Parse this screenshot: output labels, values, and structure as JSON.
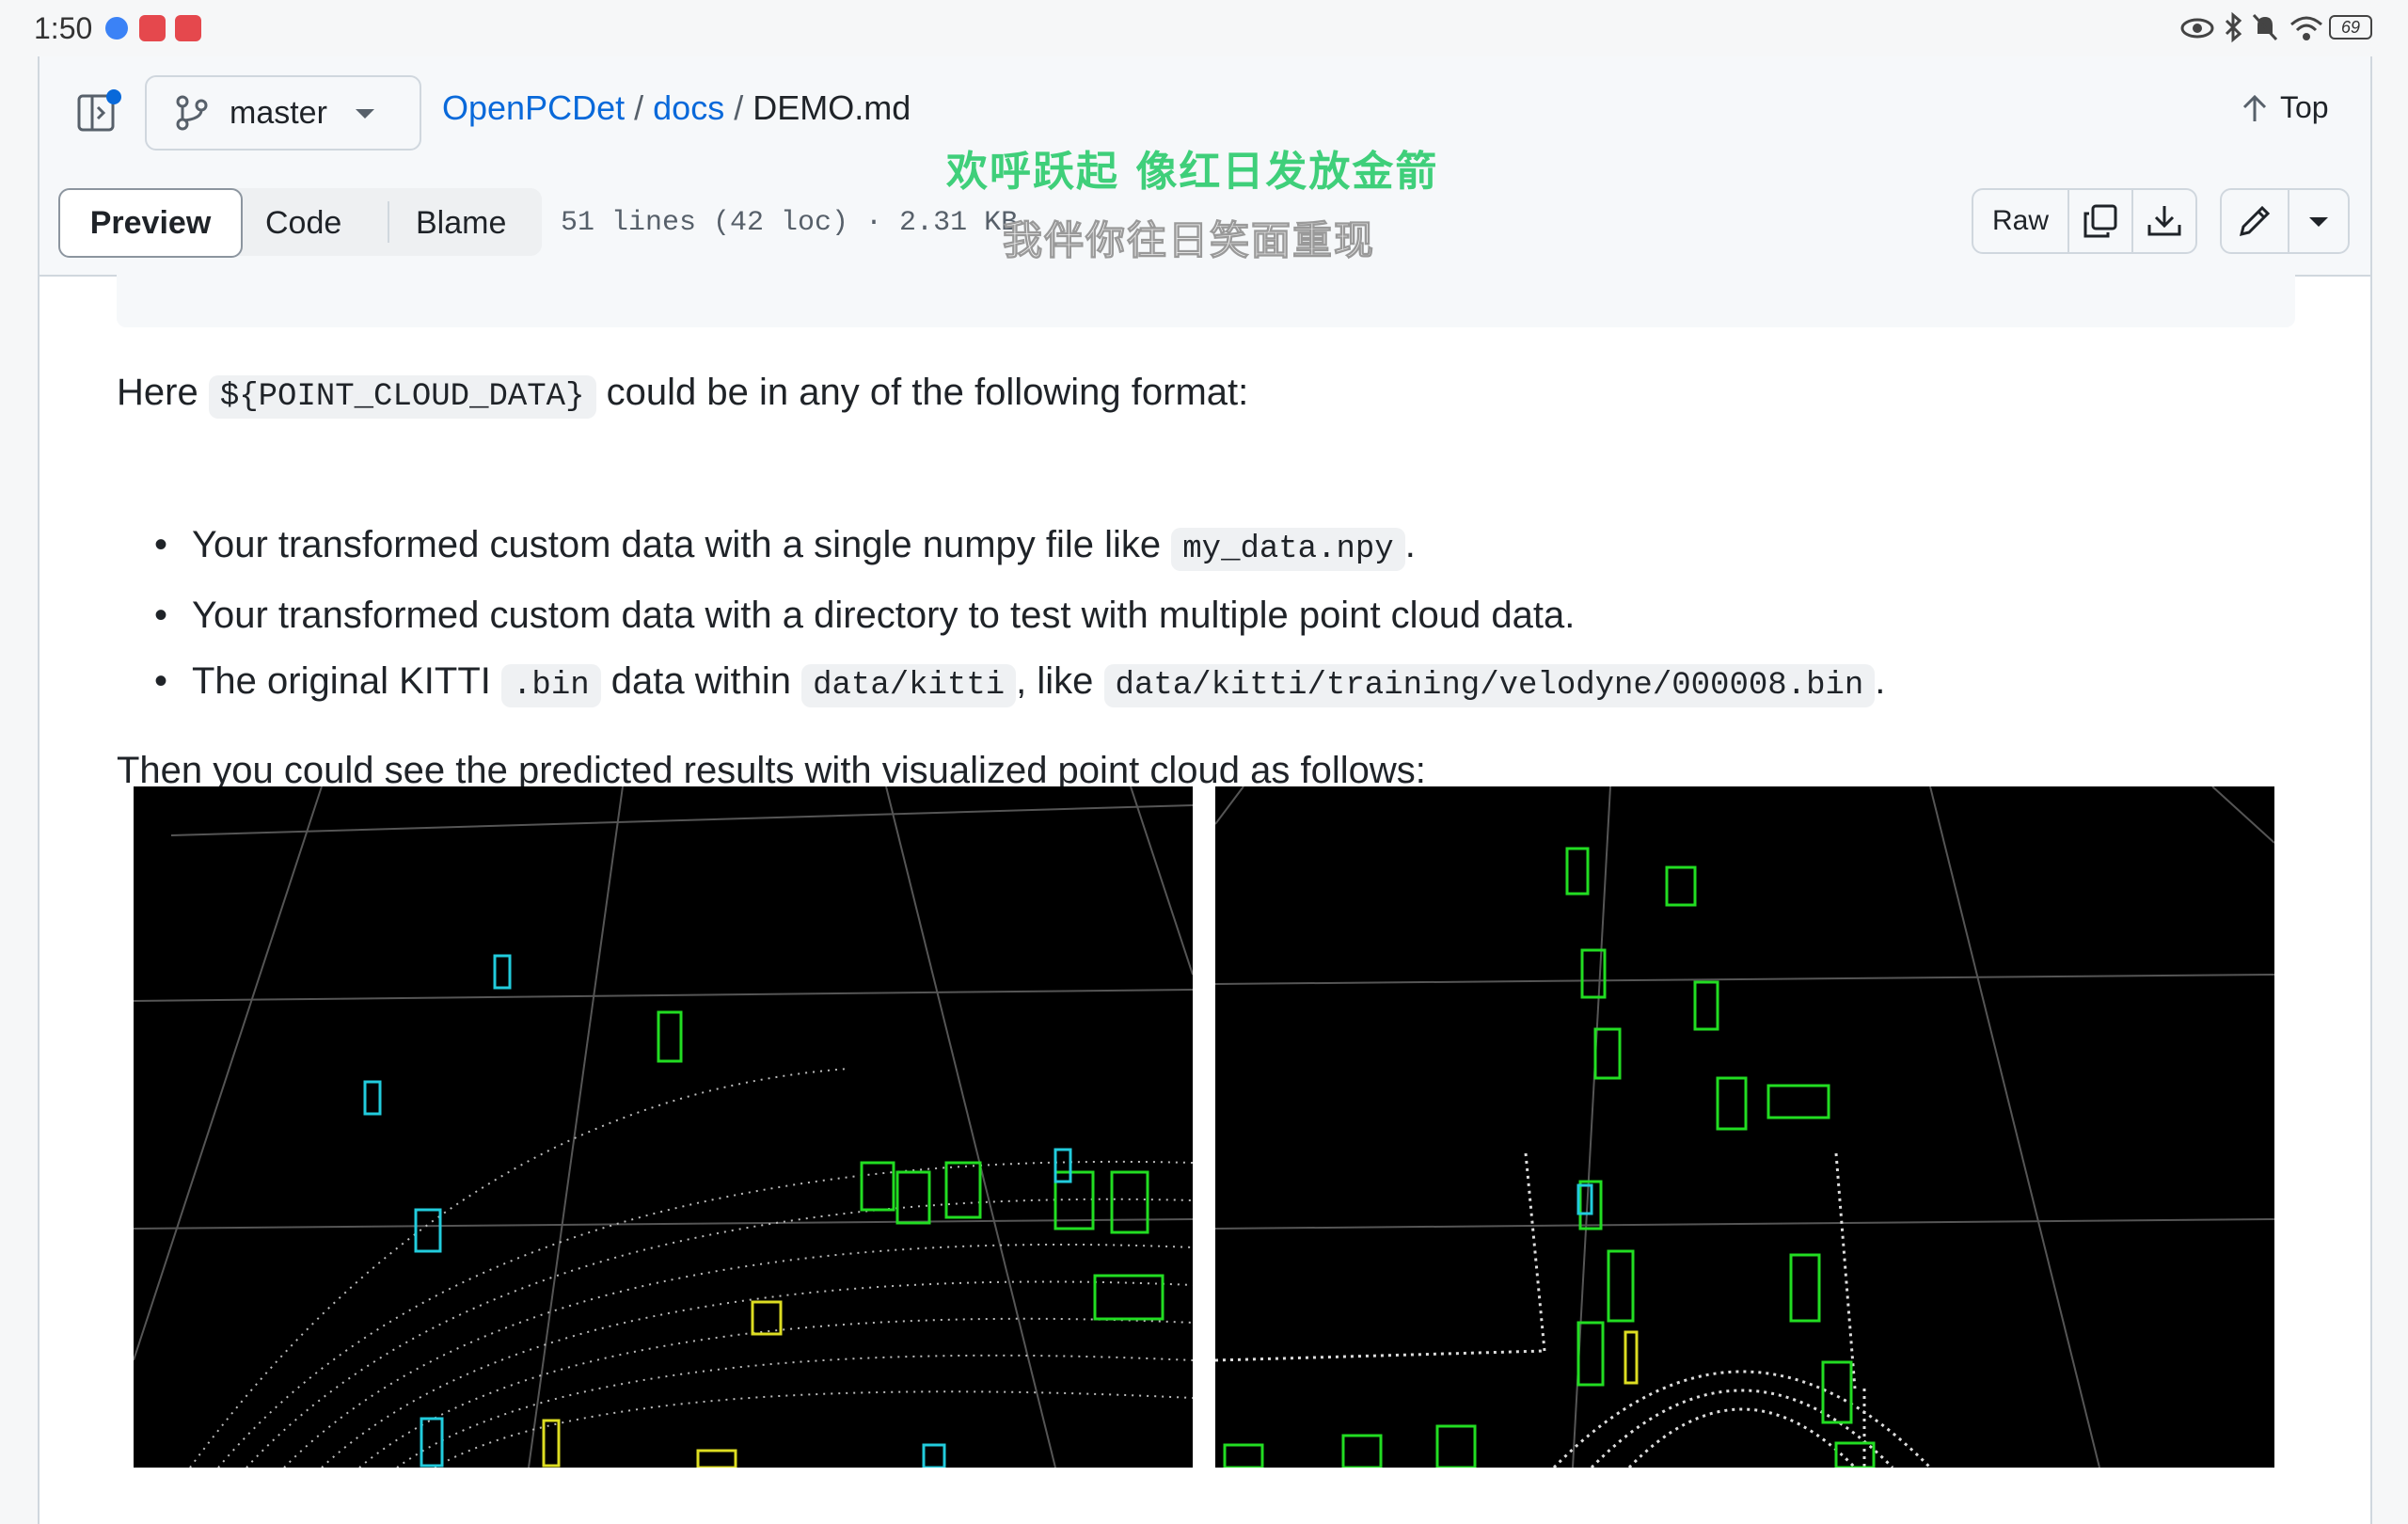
{
  "status_bar": {
    "time": "1:50",
    "app_icons": [
      "blue-dot-app-icon",
      "red-app-icon",
      "red-app-icon-2"
    ],
    "battery": "69",
    "indicators": [
      "eye-icon",
      "bluetooth-icon",
      "mute-icon",
      "wifi-icon",
      "battery-icon"
    ]
  },
  "header": {
    "branch": "master",
    "breadcrumb": {
      "repo": "OpenPCDet",
      "sep1": "/",
      "folder": "docs",
      "sep2": "/",
      "file": "DEMO.md"
    },
    "top_label": "Top"
  },
  "toolbar": {
    "tabs": [
      {
        "label": "Preview",
        "active": true
      },
      {
        "label": "Code",
        "active": false
      },
      {
        "label": "Blame",
        "active": false
      }
    ],
    "file_info": "51 lines (42 loc) · 2.31 KB",
    "raw_label": "Raw"
  },
  "overlay": {
    "line1": "欢呼跃起 像红日发放金箭",
    "line2": "我伴你往日笑面重现"
  },
  "content": {
    "intro": {
      "before": "Here",
      "code": "${POINT_CLOUD_DATA}",
      "after": "could be in any of the following format:"
    },
    "bullets": {
      "b1": {
        "text": "Your transformed custom data with a single numpy file like",
        "code": "my_data.npy",
        "end": "."
      },
      "b2": {
        "text": "Your transformed custom data with a directory to test with multiple point cloud data."
      },
      "b3": {
        "t1": "The original KITTI",
        "c1": ".bin",
        "t2": "data within",
        "c2": "data/kitti",
        "t3": ", like",
        "c3": "data/kitti/training/velodyne/000008.bin",
        "end": "."
      }
    },
    "outro": "Then you could see the predicted results with visualized point cloud as follows:"
  },
  "colors": {
    "link": "#0969da",
    "box_green": "#22dd22",
    "box_cyan": "#22ccdd",
    "box_yellow": "#dddd22",
    "overlay_green": "#3fcf7a"
  }
}
